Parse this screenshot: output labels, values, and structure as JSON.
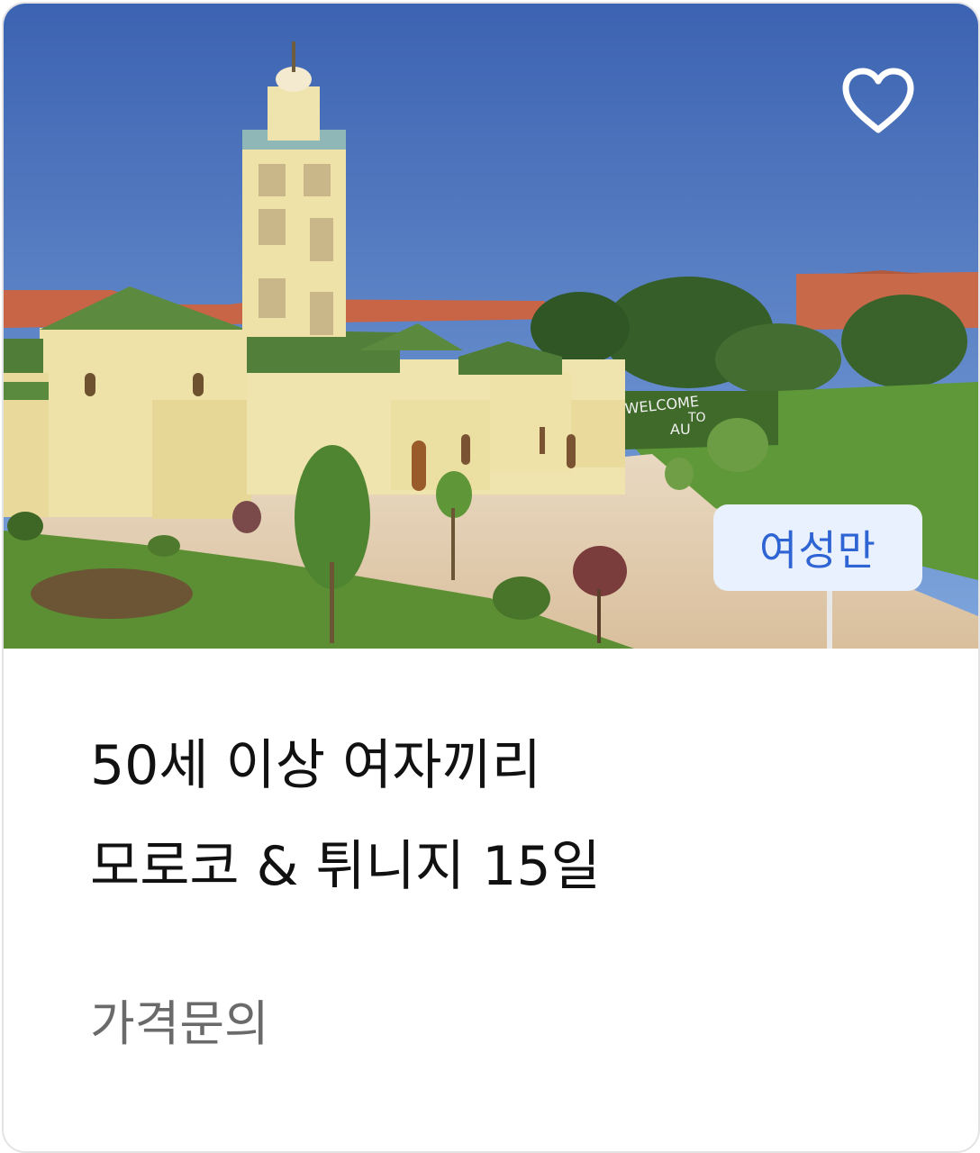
{
  "card": {
    "image": {
      "description_icon": "mosque-photo",
      "sign_text": [
        "WELCOME",
        "TO",
        "AU"
      ]
    },
    "favorite_icon": "heart-outline-icon",
    "badge": "여성만",
    "title_lines": [
      "50세 이상 여자끼리",
      "모로코 & 튀니지 15일"
    ],
    "price_label": "가격문의"
  },
  "colors": {
    "badge_bg": "#e8f1fd",
    "badge_text": "#2f64d4",
    "title_text": "#111111",
    "price_text": "#6a6a6a",
    "border": "#e3e3e6"
  }
}
